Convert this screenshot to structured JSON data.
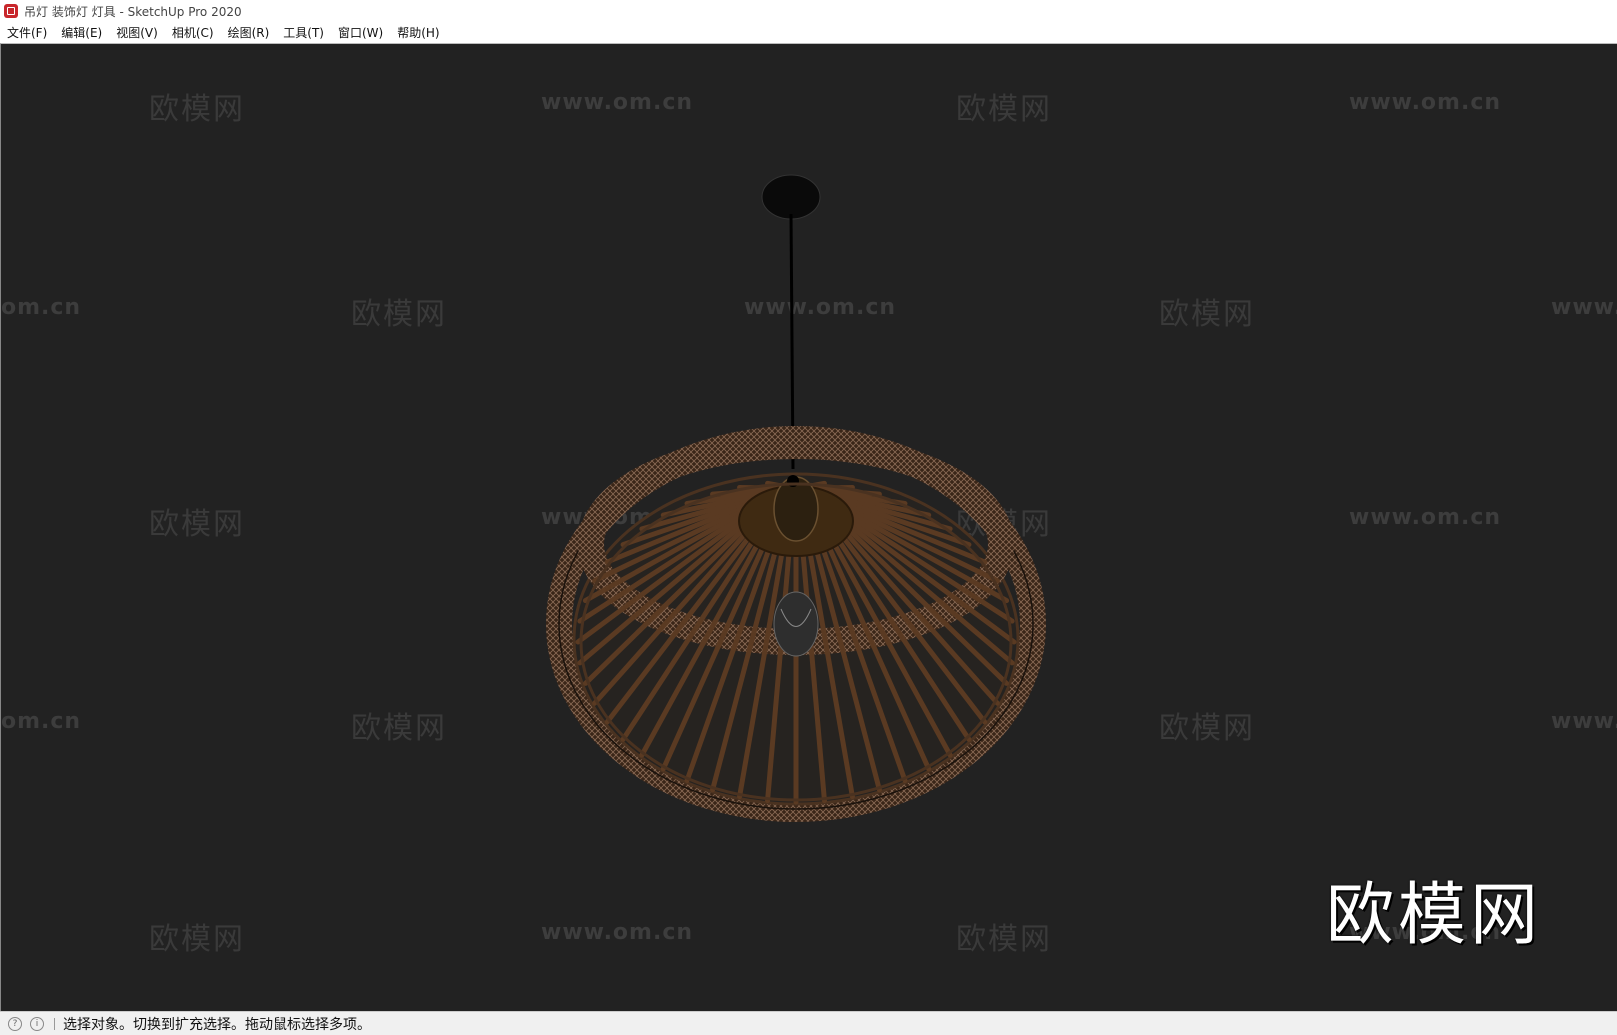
{
  "window": {
    "title": "吊灯 装饰灯 灯具 - SketchUp Pro 2020"
  },
  "menu": [
    {
      "label": "文件(F)"
    },
    {
      "label": "编辑(E)"
    },
    {
      "label": "视图(V)"
    },
    {
      "label": "相机(C)"
    },
    {
      "label": "绘图(R)"
    },
    {
      "label": "工具(T)"
    },
    {
      "label": "窗口(W)"
    },
    {
      "label": "帮助(H)"
    }
  ],
  "watermarks": {
    "url": "www.om.cn",
    "url_partial_left": "om.cn",
    "url_partial_right": "www.",
    "brand": "欧模网",
    "large": "欧模网"
  },
  "statusbar": {
    "text": "选择对象。切换到扩充选择。拖动鼠标选择多项。",
    "icons": [
      "geo-location-icon",
      "info-icon"
    ]
  },
  "colors": {
    "viewport_bg": "#222222",
    "lamp_wood": "#5a3a22",
    "lamp_highlight": "#8a6a4a"
  }
}
